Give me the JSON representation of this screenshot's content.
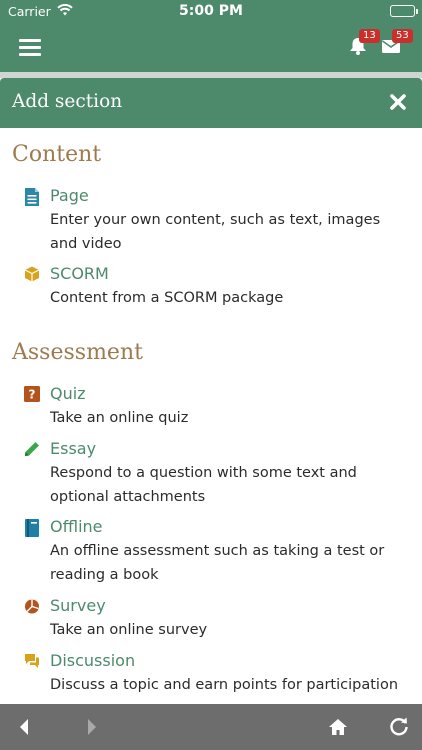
{
  "status_bar": {
    "carrier": "Carrier",
    "time": "5:00 PM"
  },
  "header": {
    "notifications_count": "13",
    "messages_count": "53"
  },
  "modal": {
    "title": "Add section",
    "sections": [
      {
        "heading": "Content",
        "items": [
          {
            "icon": "page-icon",
            "name": "Page",
            "desc": "Enter your own content, such as text, images and video"
          },
          {
            "icon": "scorm-icon",
            "name": "SCORM",
            "desc": "Content from a SCORM package"
          }
        ]
      },
      {
        "heading": "Assessment",
        "items": [
          {
            "icon": "quiz-icon",
            "name": "Quiz",
            "desc": "Take an online quiz"
          },
          {
            "icon": "pencil-icon",
            "name": "Essay",
            "desc": "Respond to a question with some text and optional attachments"
          },
          {
            "icon": "book-icon",
            "name": "Offline",
            "desc": "An offline assessment such as taking a test or reading a book"
          },
          {
            "icon": "pie-chart-icon",
            "name": "Survey",
            "desc": "Take an online survey"
          },
          {
            "icon": "speech-bubbles-icon",
            "name": "Discussion",
            "desc": "Discuss a topic and earn points for participation"
          }
        ]
      }
    ]
  },
  "colors": {
    "brand_green": "#4d8a6c",
    "heading_gold": "#9c7b4e",
    "badge_red": "#c9302c",
    "bottom_bar": "#6d6d6d"
  }
}
